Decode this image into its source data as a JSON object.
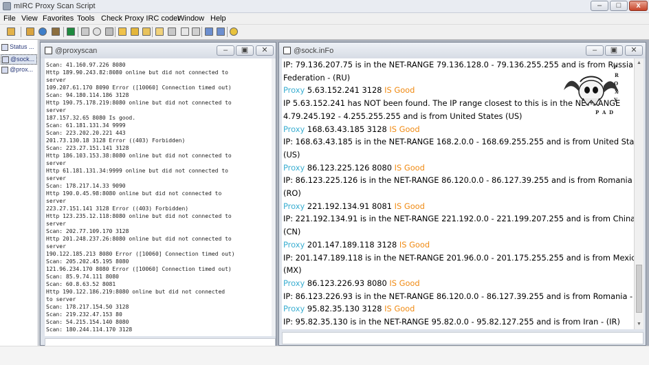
{
  "app": {
    "title": "mIRC Proxy Scan Script"
  },
  "menu": [
    "File",
    "View",
    "Favorites",
    "Tools",
    "Check Proxy IRC coder",
    "Window",
    "Help"
  ],
  "caption_buttons": {
    "minimize": "–",
    "maximize": "□",
    "close": "x"
  },
  "window_buttons": {
    "minimize": "–",
    "restore": "▣",
    "close": "✕"
  },
  "treebar": {
    "items": [
      "Status ...",
      "@sock...",
      "@prox..."
    ]
  },
  "proxyscan": {
    "title": "@proxyscan",
    "lines": [
      "Scan: 41.160.97.226 8080",
      "Http 189.90.243.82:8080 online but did not connected to",
      "server",
      "109.207.61.170 8090 Error ([10060] Connection timed out)",
      "Scan: 94.180.114.186 3128",
      "Http 190.75.178.219:8080 online but did not connected to",
      "server",
      "187.157.32.65 8080 Is good.",
      "Scan: 61.181.131.34 9999",
      "Scan: 223.202.20.221 443",
      "201.73.130.18 3128 Error ((403) Forbidden)",
      "Scan: 223.27.151.141 3128",
      "Http 186.103.153.38:8080 online but did not connected to",
      "server",
      "Http 61.181.131.34:9999 online but did not connected to",
      "server",
      "Scan: 178.217.14.33 9090",
      "Http 190.0.45.98:8080 online but did not connected to",
      "server",
      "223.27.151.141 3128 Error ((403) Forbidden)",
      "Http 123.235.12.118:8080 online but did not connected to",
      "server",
      "Scan: 202.77.109.170 3128",
      "Http 201.248.237.26:8080 online but did not connected to",
      "server",
      "190.122.185.213 8080 Error ([10060] Connection timed out)",
      "Scan: 205.202.45.195 8080",
      "121.96.234.170 8080 Error ([10060] Connection timed out)",
      "Scan: 85.9.74.111 8080",
      "Scan: 60.8.63.52 8081",
      "Http 190.122.186.219:8080 online but did not connected",
      "to server",
      "Scan: 178.217.154.50 3128",
      "Scan: 219.232.47.153 80",
      "Scan: 54.215.154.140 8080",
      "Scan: 180.244.114.170 3128"
    ]
  },
  "sockinfo": {
    "title": "@sock.inFo",
    "logo_letters": [
      "P",
      "R",
      "O",
      "X",
      "Y",
      "P",
      "A",
      "D"
    ],
    "lines": [
      {
        "kind": "ip",
        "text": "IP: 79.136.207.75 is in the NET-RANGE 79.136.128.0 - 79.136.255.255 and is from Russian"
      },
      {
        "kind": "ip",
        "text": "Federation - (RU)"
      },
      {
        "kind": "proxy",
        "label": "Proxy",
        "addr": "5.63.152.241 3128",
        "status": "IS Good"
      },
      {
        "kind": "ip",
        "text": "IP 5.63.152.241 has NOT been found. The IP range closest to this is in the NET-RANGE"
      },
      {
        "kind": "ip",
        "text": "4.79.245.192 - 4.255.255.255 and is from United States (US)"
      },
      {
        "kind": "proxy",
        "label": "Proxy",
        "addr": "168.63.43.185 3128",
        "status": "IS Good"
      },
      {
        "kind": "ip",
        "text": "IP: 168.63.43.185 is in the NET-RANGE 168.2.0.0 - 168.69.255.255 and is from United States -"
      },
      {
        "kind": "ip",
        "text": "(US)"
      },
      {
        "kind": "proxy",
        "label": "Proxy",
        "addr": "86.123.225.126 8080",
        "status": "IS Good"
      },
      {
        "kind": "ip",
        "text": "IP: 86.123.225.126 is in the NET-RANGE 86.120.0.0 - 86.127.39.255 and is from Romania -"
      },
      {
        "kind": "ip",
        "text": "(RO)"
      },
      {
        "kind": "proxy",
        "label": "Proxy",
        "addr": "221.192.134.91 8081",
        "status": "IS Good"
      },
      {
        "kind": "ip",
        "text": "IP: 221.192.134.91 is in the NET-RANGE 221.192.0.0 - 221.199.207.255 and is from China -"
      },
      {
        "kind": "ip",
        "text": "(CN)"
      },
      {
        "kind": "proxy",
        "label": "Proxy",
        "addr": "201.147.189.118 3128",
        "status": "IS Good"
      },
      {
        "kind": "ip",
        "text": "IP: 201.147.189.118 is in the NET-RANGE 201.96.0.0 - 201.175.255.255 and is from Mexico -"
      },
      {
        "kind": "ip",
        "text": "(MX)"
      },
      {
        "kind": "proxy",
        "label": "Proxy",
        "addr": "86.123.226.93 8080",
        "status": "IS Good"
      },
      {
        "kind": "ip",
        "text": "IP: 86.123.226.93 is in the NET-RANGE 86.120.0.0 - 86.127.39.255 and is from Romania - (RO)"
      },
      {
        "kind": "proxy",
        "label": "Proxy",
        "addr": "95.82.35.130 3128",
        "status": "IS Good"
      },
      {
        "kind": "ip",
        "text": "IP: 95.82.35.130 is in the NET-RANGE 95.82.0.0 - 95.82.127.255 and is from Iran - (IR)"
      }
    ]
  },
  "colors": {
    "proxy_label": "#3aaed1",
    "good_status": "#f08a12",
    "mdi_background": "#aab0bb"
  }
}
